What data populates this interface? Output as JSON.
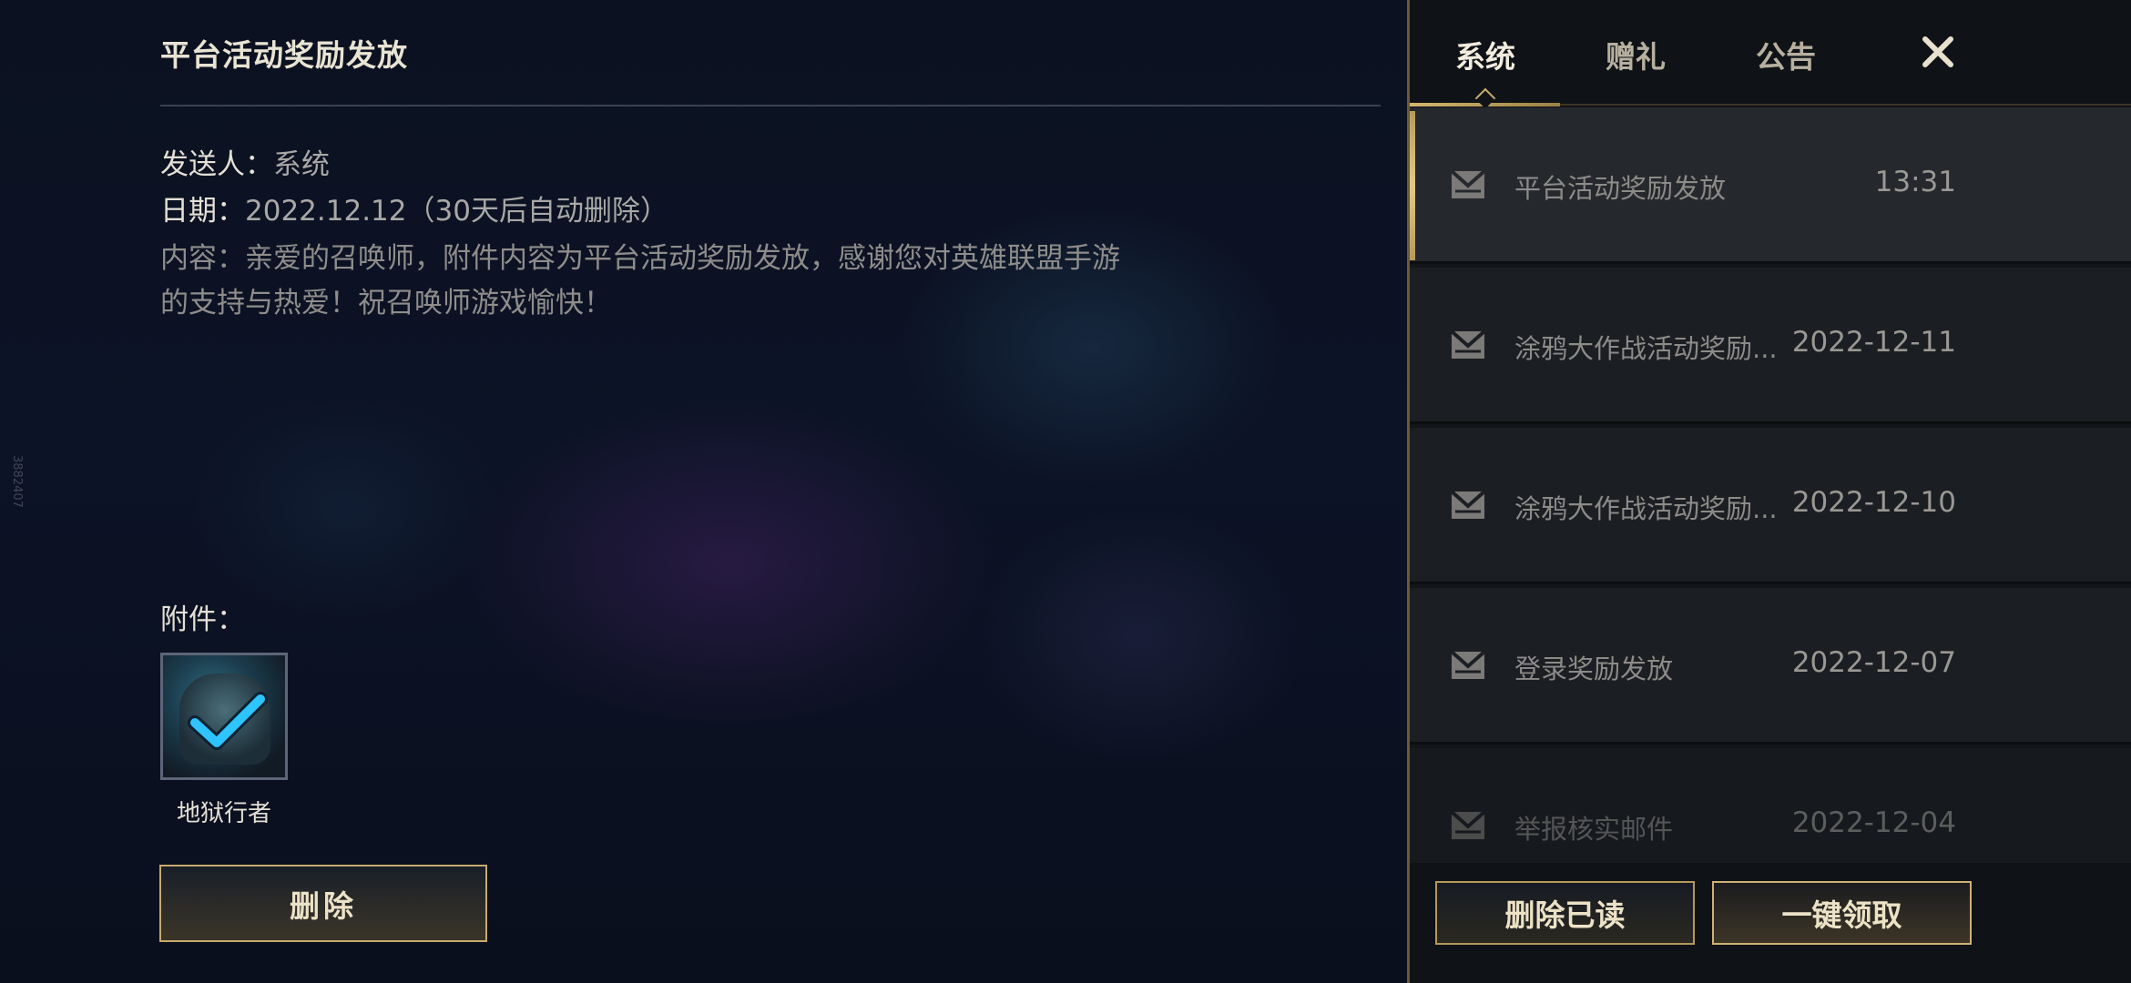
{
  "side_id": "3882407",
  "detail": {
    "title": "平台活动奖励发放",
    "sender_label": "发送人：",
    "sender_value": "系统",
    "date_label": "日期：",
    "date_value": "2022.12.12（30天后自动删除）",
    "content_line1": "内容：亲爱的召唤师，附件内容为平台活动奖励发放，感谢您对英雄联盟手游",
    "content_line2": "的支持与热爱！祝召唤师游戏愉快！",
    "attachment_label": "附件：",
    "attachment_name": "地狱行者",
    "delete_label": "删除"
  },
  "tabs": {
    "system": "系统",
    "gift": "赠礼",
    "notice": "公告",
    "active": "system"
  },
  "mails": [
    {
      "subject": "平台活动奖励发放",
      "date": "13:31",
      "selected": true
    },
    {
      "subject": "涂鸦大作战活动奖励...",
      "date": "2022-12-11",
      "selected": false
    },
    {
      "subject": "涂鸦大作战活动奖励...",
      "date": "2022-12-10",
      "selected": false
    },
    {
      "subject": "登录奖励发放",
      "date": "2022-12-07",
      "selected": false
    },
    {
      "subject": "举报核实邮件",
      "date": "2022-12-04",
      "selected": false
    }
  ],
  "footer": {
    "delete_read": "删除已读",
    "claim_all": "一键领取"
  },
  "colors": {
    "gold_accent": "#c8aa6e",
    "panel_bg": "#121519",
    "check_blue": "#2ec4ff"
  },
  "icons": {
    "close": "close-icon",
    "envelope": "envelope-icon",
    "check": "check-icon"
  }
}
